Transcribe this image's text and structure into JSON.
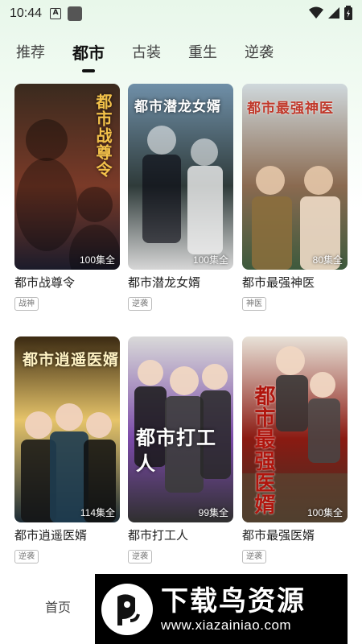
{
  "status": {
    "time": "10:44",
    "notification_letter": "A"
  },
  "tabs": [
    {
      "label": "推荐"
    },
    {
      "label": "都市"
    },
    {
      "label": "古装"
    },
    {
      "label": "重生"
    },
    {
      "label": "逆袭"
    }
  ],
  "active_tab": "都市",
  "dramas": [
    {
      "title": "都市战尊令",
      "episodes": "100集全",
      "tag": "战神",
      "poster_text": "都市战尊令",
      "colors": [
        "#3a2a1e",
        "#7a3a28",
        "#1b1b2a"
      ]
    },
    {
      "title": "都市潜龙女婿",
      "episodes": "100集全",
      "tag": "逆袭",
      "poster_text": "都市潜龙女婿",
      "colors": [
        "#6f8fa8",
        "#2f3b3a",
        "#d6d6d6"
      ]
    },
    {
      "title": "都市最强神医",
      "episodes": "80集全",
      "tag": "神医",
      "poster_text": "都市最强神医",
      "colors": [
        "#cfd8dc",
        "#8a6a50",
        "#3d5a3d"
      ]
    },
    {
      "title": "都市逍遥医婿",
      "episodes": "114集全",
      "tag": "逆袭",
      "poster_text": "都市逍遥医婿",
      "colors": [
        "#3b2a12",
        "#e6c46a",
        "#1c2b35"
      ]
    },
    {
      "title": "都市打工人",
      "episodes": "99集全",
      "tag": "逆袭",
      "poster_text": "都市打工人",
      "colors": [
        "#d9d9d9",
        "#7a4aa8",
        "#2f2f2f"
      ]
    },
    {
      "title": "都市最强医婿",
      "episodes": "100集全",
      "tag": "逆袭",
      "poster_text": "都市最强医婿",
      "colors": [
        "#e8e2d8",
        "#8a1a12",
        "#3a3228"
      ]
    }
  ],
  "bottom_nav": {
    "home_label": "首页"
  },
  "watermark": {
    "name": "下载鸟资源",
    "url": "www.xiazainiao.com"
  }
}
